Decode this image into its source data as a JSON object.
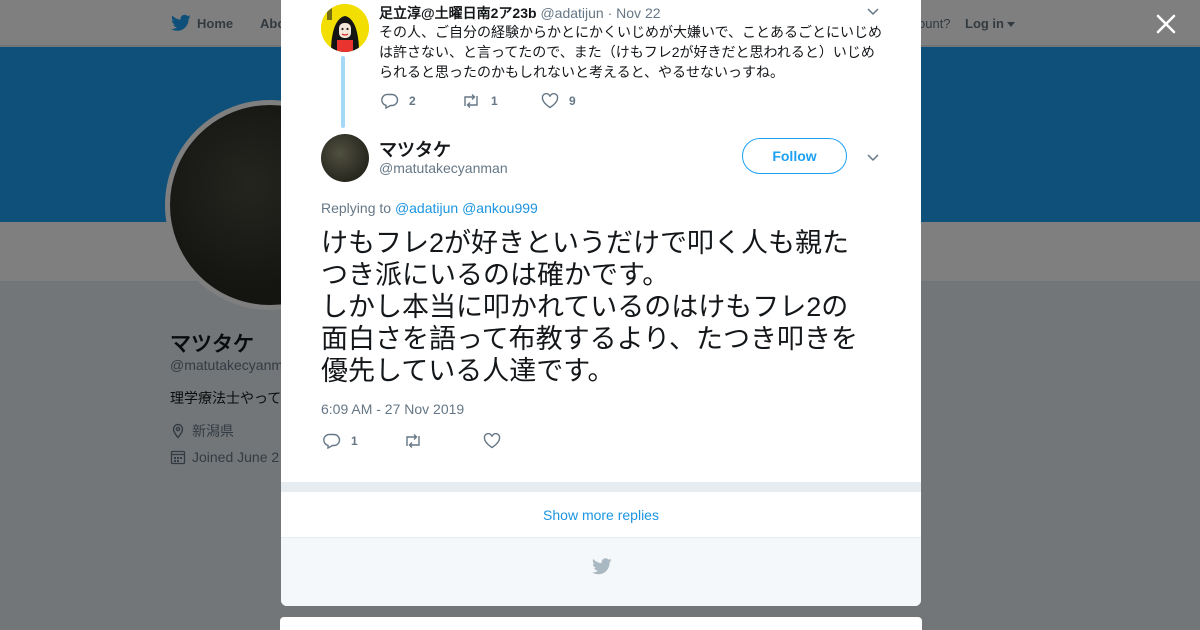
{
  "topbar": {
    "home_label": "Home",
    "about_label": "Abo",
    "account_question": "ccount?",
    "login_label": "Log in"
  },
  "profile": {
    "name": "マツタケ",
    "handle": "@matutakecyanm",
    "bio": "理学療法士やって",
    "location": "新潟県",
    "joined": "Joined June 2"
  },
  "reply_tweet": {
    "name": "足立淳@土曜日南2ア23b",
    "handle": "@adatijun",
    "date": "· Nov 22",
    "text": "その人、ご自分の経験からかとにかくいじめが大嫌いで、ことあるごとにいじめは許さない、と言ってたので、また（けもフレ2が好きだと思われると）いじめられると思ったのかもしれないと考えると、やるせないっすね。",
    "reply_count": "2",
    "retweet_count": "1",
    "like_count": "9"
  },
  "main_tweet": {
    "name": "マツタケ",
    "handle": "@matutakecyanman",
    "follow_label": "Follow",
    "replying_prefix": "Replying to",
    "replying_to": [
      "@adatijun",
      "@ankou999"
    ],
    "text_lines": [
      "けもフレ2が好きというだけで叩く人も親た",
      "つき派にいるのは確かです。",
      "しかし本当に叩かれているのはけもフレ2の",
      "面白さを語って布教するより、たつき叩きを",
      "優先している人達です。"
    ],
    "timestamp": "6:09 AM - 27 Nov 2019",
    "reply_count": "1"
  },
  "show_more_label": "Show more replies",
  "colors": {
    "accent": "#1da1f2",
    "link": "#1b95e0",
    "muted": "#657786",
    "banner": "#1da1f2"
  }
}
